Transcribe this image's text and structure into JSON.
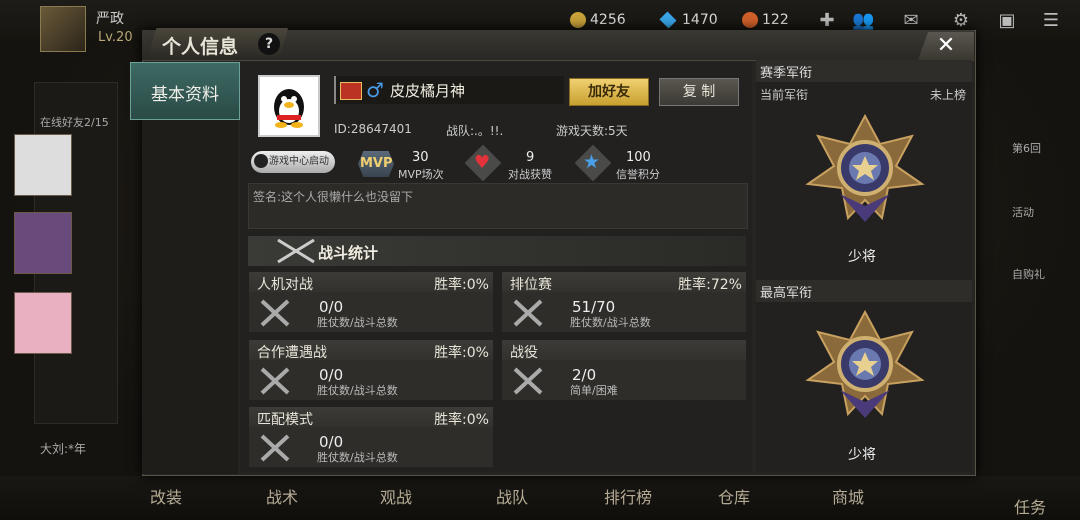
{
  "topbar": {
    "player_name": "严政",
    "level": "Lv.20",
    "gold": "4256",
    "diamonds": "1470",
    "tickets": "122"
  },
  "left_panel": {
    "online_friends": "在线好友2/15",
    "chat_preview": "大刘:*年"
  },
  "dialog": {
    "title": "个人信息",
    "help": "?",
    "close": "✕",
    "side_tab": "基本资料"
  },
  "profile": {
    "nickname": "皮皮橘月神",
    "gender_symbol": "♂",
    "add_friend": "加好友",
    "copy": "复 制",
    "id": "ID:28647401",
    "team": "战队:.。!!.",
    "days": "游戏天数:5天",
    "game_center": "游戏中心启动",
    "mvp_label": "MVP",
    "mvp_value": "30",
    "mvp_caption": "MVP场次",
    "likes_value": "9",
    "likes_caption": "对战获赞",
    "credit_value": "100",
    "credit_caption": "信誉积分",
    "signature": "签名:这个人很懒什么也没留下"
  },
  "battle": {
    "header": "战斗统计",
    "cards": [
      {
        "title": "人机对战",
        "winrate": "胜率:0%",
        "value": "0/0",
        "caption": "胜仗数/战斗总数"
      },
      {
        "title": "排位赛",
        "winrate": "胜率:72%",
        "value": "51/70",
        "caption": "胜仗数/战斗总数"
      },
      {
        "title": "合作遭遇战",
        "winrate": "胜率:0%",
        "value": "0/0",
        "caption": "胜仗数/战斗总数"
      },
      {
        "title": "战役",
        "winrate": "",
        "value": "2/0",
        "caption": "简单/困难"
      },
      {
        "title": "匹配模式",
        "winrate": "胜率:0%",
        "value": "0/0",
        "caption": "胜仗数/战斗总数"
      }
    ]
  },
  "rank": {
    "season_header": "赛季军衔",
    "current_label": "当前军衔",
    "current_status": "未上榜",
    "current_rank": "少将",
    "highest_label": "最高军衔",
    "highest_rank": "少将"
  },
  "bottom_nav": [
    "改装",
    "战术",
    "观战",
    "战队",
    "排行榜",
    "仓库",
    "商城",
    "任务"
  ],
  "right_side": [
    "第6回",
    "活动",
    "自购礼"
  ],
  "colors": {
    "accent_gold": "#e8c060",
    "tab_teal": "#3e6a64"
  }
}
